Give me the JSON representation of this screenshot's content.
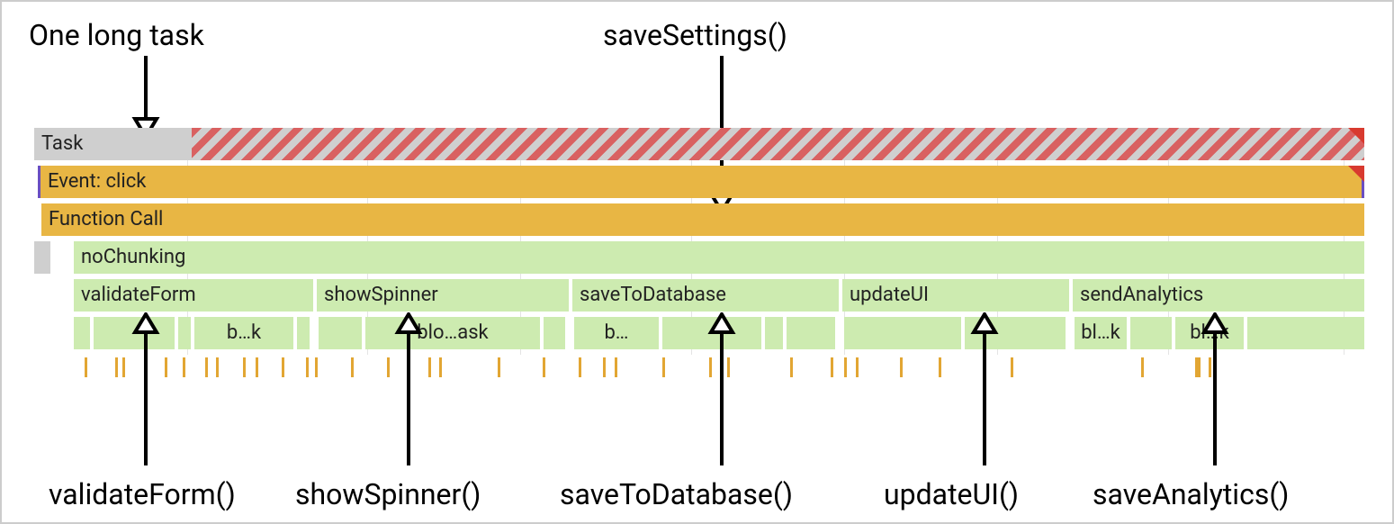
{
  "annotations": {
    "top_left": "One long task",
    "top_right": "saveSettings()",
    "bottom": {
      "validateForm": "validateForm()",
      "showSpinner": "showSpinner()",
      "saveToDatabase": "saveToDatabase()",
      "updateUI": "updateUI()",
      "saveAnalytics": "saveAnalytics()"
    }
  },
  "rows": {
    "task": "Task",
    "event": "Event: click",
    "function_call": "Function Call",
    "nochunking": "noChunking"
  },
  "functions": {
    "validateForm": "validateForm",
    "showSpinner": "showSpinner",
    "saveToDatabase": "saveToDatabase",
    "updateUI": "updateUI",
    "sendAnalytics": "sendAnalytics"
  },
  "subblocks": {
    "b1": "b…k",
    "b2": "blo…ask",
    "b3": "b…",
    "b4": "bl…k",
    "b5": "bl…k"
  }
}
